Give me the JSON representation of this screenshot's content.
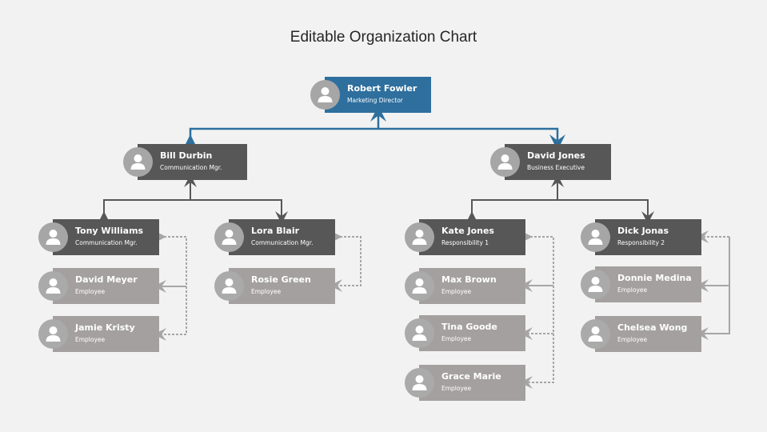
{
  "title": "Editable Organization Chart",
  "colors": {
    "background": "#f2f2f2",
    "top_box": "#2e6f9e",
    "manager_box": "#575757",
    "employee_box": "#a5a0a0",
    "avatar": "#a6a6a6",
    "top_connector": "#2e6f9e",
    "manager_connector": "#575757",
    "employee_connector": "#a6a6a6"
  },
  "root": {
    "name": "Robert Fowler",
    "role": "Marketing Director",
    "icon": "user-icon"
  },
  "level2": [
    {
      "name": "Bill Durbin",
      "role": "Communication Mgr.",
      "icon": "user-icon"
    },
    {
      "name": "David Jones",
      "role": "Business Executive",
      "icon": "user-icon"
    }
  ],
  "teams": [
    {
      "lead": {
        "name": "Tony Williams",
        "role": "Communication Mgr."
      },
      "members": [
        {
          "name": "David Meyer",
          "role": "Employee"
        },
        {
          "name": "Jamie Kristy",
          "role": "Employee"
        }
      ]
    },
    {
      "lead": {
        "name": "Lora Blair",
        "role": "Communication Mgr."
      },
      "members": [
        {
          "name": "Rosie Green",
          "role": "Employee"
        }
      ]
    },
    {
      "lead": {
        "name": "Kate Jones",
        "role": "Responsibility 1"
      },
      "members": [
        {
          "name": "Max Brown",
          "role": "Employee"
        },
        {
          "name": "Tina Goode",
          "role": "Employee"
        },
        {
          "name": "Grace Marie",
          "role": "Employee"
        }
      ]
    },
    {
      "lead": {
        "name": "Dick Jonas",
        "role": "Responsibility 2"
      },
      "members": [
        {
          "name": "Donnie Medina",
          "role": "Employee"
        },
        {
          "name": "Chelsea Wong",
          "role": "Employee"
        }
      ]
    }
  ]
}
